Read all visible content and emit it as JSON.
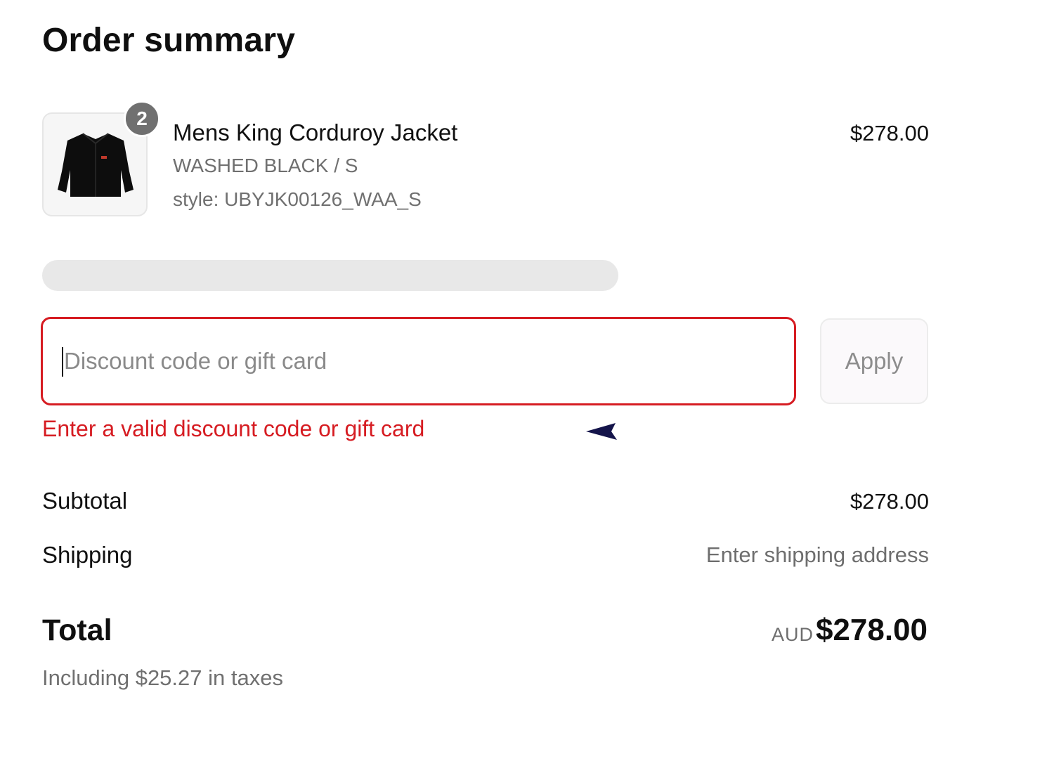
{
  "header": {
    "title": "Order summary"
  },
  "line_item": {
    "name": "Mens King Corduroy Jacket",
    "variant": "WASHED BLACK / S",
    "style": "style: UBYJK00126_WAA_S",
    "price": "$278.00",
    "quantity": "2",
    "thumbnail_icon": "jacket-icon"
  },
  "discount": {
    "placeholder": "Discount code or gift card",
    "value": "",
    "apply_label": "Apply",
    "error": "Enter a valid discount code or gift card",
    "error_color": "#d61c22"
  },
  "summary": {
    "subtotal_label": "Subtotal",
    "subtotal_value": "$278.00",
    "shipping_label": "Shipping",
    "shipping_value": "Enter shipping address",
    "total_label": "Total",
    "currency": "AUD",
    "total_value": "$278.00",
    "tax_note": "Including $25.27 in taxes"
  }
}
